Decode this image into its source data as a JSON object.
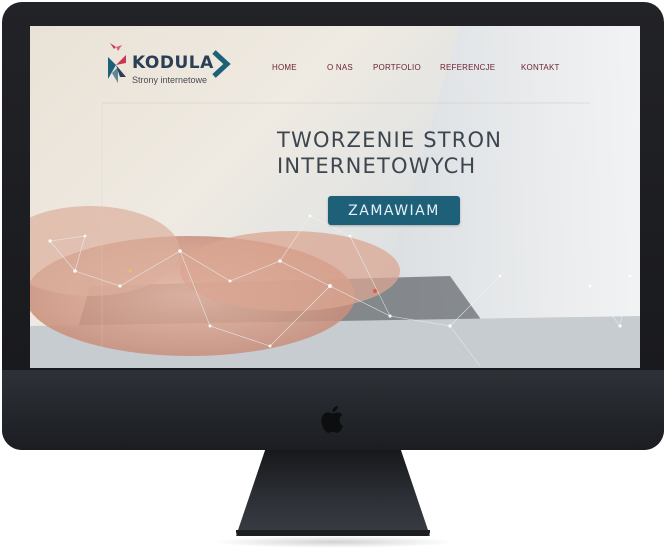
{
  "site": {
    "logo": {
      "name": "KODULA",
      "tagline": "Strony internetowe"
    },
    "nav": [
      {
        "label": "HOME"
      },
      {
        "label": "O NAS"
      },
      {
        "label": "PORTFOLIO"
      },
      {
        "label": "REFERENCJE"
      },
      {
        "label": "KONTAKT"
      }
    ],
    "hero": {
      "title": "TWORZENIE STRON\nINTERNETOWYCH",
      "cta_label": "ZAMAWIAM"
    }
  },
  "colors": {
    "nav_text": "#6b2433",
    "cta_background": "#1f6079",
    "logo_text": "#2a3f55",
    "hero_text": "#3d4650",
    "bezel": "#1b1d21"
  },
  "icons": {
    "device_logo": "apple-icon",
    "logo_arrow": "chevron-right-icon"
  }
}
